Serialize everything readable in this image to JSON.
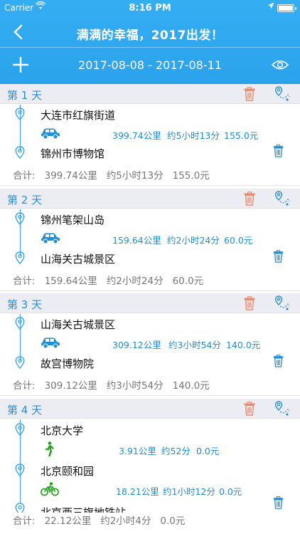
{
  "status": {
    "carrier": "Carrier",
    "time": "8:16 PM"
  },
  "nav": {
    "title": "满满的幸福，2017出发！",
    "date_range": "2017-08-08 - 2017-08-11"
  },
  "colors": {
    "header": "#2ba3ec",
    "accent": "#2a8fd8",
    "trash_red": "#e98b6f",
    "car": "#1e8fd9",
    "walk": "#21a01c"
  },
  "days": [
    {
      "label": "第 1 天",
      "places": [
        "大连市红旗街道",
        "锦州市博物馆"
      ],
      "leg": {
        "mode": "car-icon",
        "distance": "399.74公里",
        "duration": "约5小时13分",
        "cost": "155.0元"
      },
      "summary": {
        "prefix": "合计:",
        "distance": "399.74公里",
        "duration": "约5小时13分",
        "cost": "155.0元"
      }
    },
    {
      "label": "第 2 天",
      "places": [
        "锦州笔架山岛",
        "山海关古城景区"
      ],
      "leg": {
        "mode": "car-icon",
        "distance": "159.64公里",
        "duration": "约2小时24分",
        "cost": "60.0元"
      },
      "summary": {
        "prefix": "合计:",
        "distance": "159.64公里",
        "duration": "约2小时24分",
        "cost": "60.0元"
      }
    },
    {
      "label": "第 3 天",
      "places": [
        "山海关古城景区",
        "故宫博物院"
      ],
      "leg": {
        "mode": "car-icon",
        "distance": "309.12公里",
        "duration": "约3小时54分",
        "cost": "140.0元"
      },
      "summary": {
        "prefix": "合计:",
        "distance": "309.12公里",
        "duration": "约3小时54分",
        "cost": "140.0元"
      }
    },
    {
      "label": "第 4 天",
      "places": [
        "北京大学",
        "北京颐和园",
        "北京西三旗地铁站"
      ],
      "legs": [
        {
          "mode": "walk-icon",
          "distance": "3.91公里",
          "duration": "约52分",
          "cost": "0.0元"
        },
        {
          "mode": "bike-icon",
          "distance": "18.21公里",
          "duration": "约1小时12分",
          "cost": "0.0元"
        }
      ],
      "summary": {
        "prefix": "合计:",
        "distance": "22.12公里",
        "duration": "约2小时4分",
        "cost": "0.0元"
      }
    }
  ]
}
